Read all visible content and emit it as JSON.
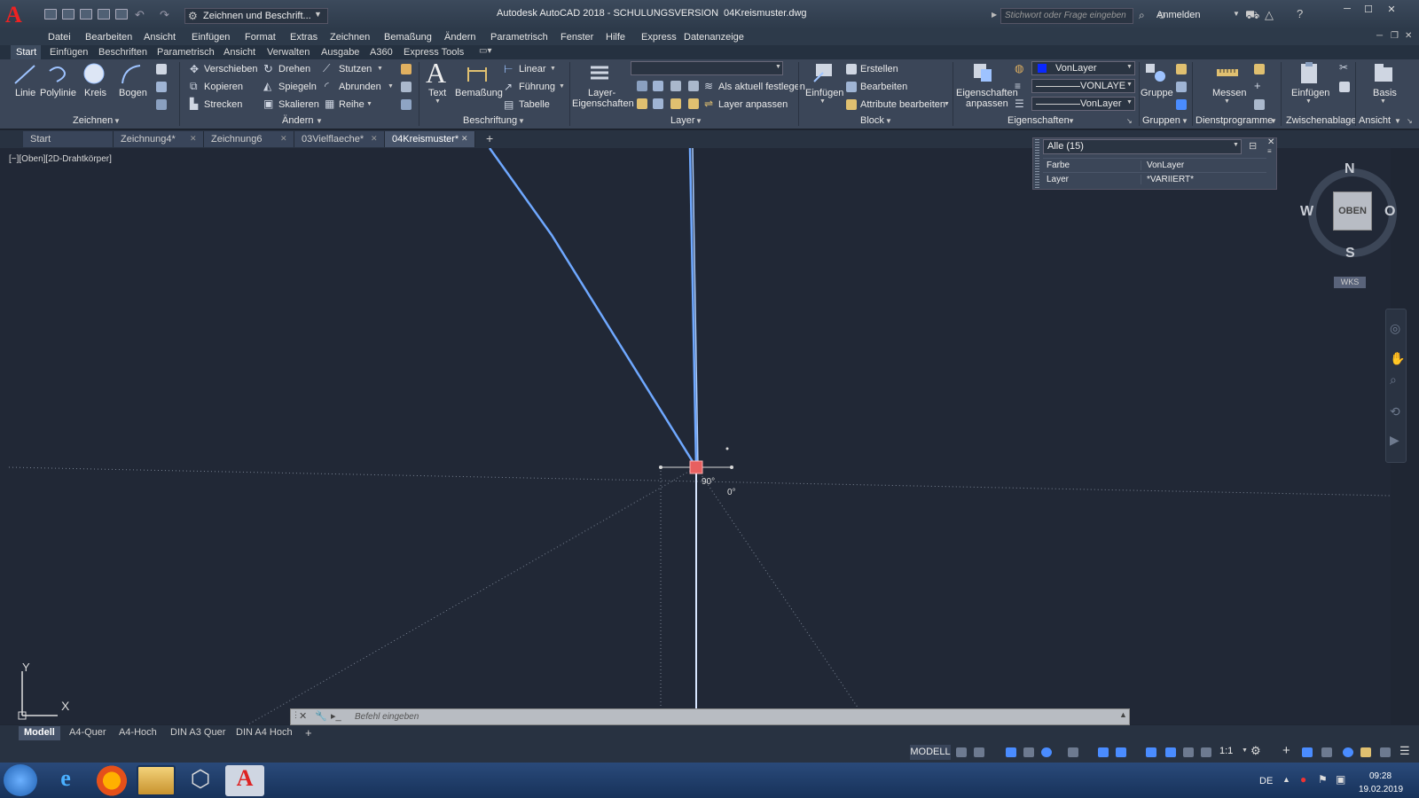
{
  "titlebar": {
    "workspace": "Zeichnen und Beschrift...",
    "app_title": "Autodesk AutoCAD 2018 - SCHULUNGSVERSION",
    "file_title": "04Kreismuster.dwg",
    "search_placeholder": "Stichwort oder Frage eingeben",
    "login": "Anmelden"
  },
  "menu": [
    "Datei",
    "Bearbeiten",
    "Ansicht",
    "Einfügen",
    "Format",
    "Extras",
    "Zeichnen",
    "Bemaßung",
    "Ändern",
    "Parametrisch",
    "Fenster",
    "Hilfe",
    "Express",
    "Datenanzeige"
  ],
  "ribbon_tabs": [
    "Start",
    "Einfügen",
    "Beschriften",
    "Parametrisch",
    "Ansicht",
    "Verwalten",
    "Ausgabe",
    "A360",
    "Express Tools"
  ],
  "ribbon": {
    "zeichnen": {
      "title": "Zeichnen",
      "linie": "Linie",
      "polylinie": "Polylinie",
      "kreis": "Kreis",
      "bogen": "Bogen"
    },
    "aendern": {
      "title": "Ändern",
      "verschieben": "Verschieben",
      "drehen": "Drehen",
      "stutzen": "Stutzen",
      "kopieren": "Kopieren",
      "spiegeln": "Spiegeln",
      "abrunden": "Abrunden",
      "strecken": "Strecken",
      "skalieren": "Skalieren",
      "reihe": "Reihe"
    },
    "beschriftung": {
      "title": "Beschriftung",
      "text": "Text",
      "bemassung": "Bemaßung",
      "linear": "Linear",
      "fuehrung": "Führung",
      "tabelle": "Tabelle"
    },
    "layer": {
      "title": "Layer",
      "eigenschaften_1": "Layer-",
      "eigenschaften_2": "Eigenschaften",
      "aktuell": "Als aktuell festlegen",
      "anpassen": "Layer anpassen"
    },
    "block": {
      "title": "Block",
      "einfuegen": "Einfügen",
      "erstellen": "Erstellen",
      "bearbeiten": "Bearbeiten",
      "attribute": "Attribute bearbeiten"
    },
    "eigenschaften": {
      "title": "Eigenschaften",
      "anpassen_1": "Eigenschaften",
      "anpassen_2": "anpassen",
      "color": "VonLayer",
      "linetype": "VONLAYE",
      "lineweight": "VonLayer"
    },
    "gruppen": {
      "title": "Gruppen",
      "gruppe": "Gruppe"
    },
    "dienst": {
      "title": "Dienstprogramme",
      "messen": "Messen"
    },
    "zwischenablage": {
      "title": "Zwischenablage",
      "einfuegen": "Einfügen"
    },
    "ansicht": {
      "title": "Ansicht",
      "basis": "Basis"
    }
  },
  "doc_tabs": [
    "Start",
    "Zeichnung4*",
    "Zeichnung6",
    "03Vielflaeche*",
    "04Kreismuster*"
  ],
  "viewport_label": "[−][Oben][2D-Drahtkörper]",
  "properties": {
    "selection": "Alle (15)",
    "rows": [
      {
        "key": "Farbe",
        "value": "VonLayer"
      },
      {
        "key": "Layer",
        "value": "*VARIIERT*"
      }
    ]
  },
  "viewcube": {
    "n": "N",
    "s": "S",
    "w": "W",
    "o": "O",
    "face": "OBEN",
    "wcs": "WKS"
  },
  "canvas": {
    "angle_label": "90°",
    "zero_label": "0°",
    "ucs_x": "X",
    "ucs_y": "Y"
  },
  "command": {
    "placeholder": "Befehl eingeben"
  },
  "layout_tabs": [
    "Modell",
    "A4-Quer",
    "A4-Hoch",
    "DIN A3 Quer",
    "DIN A4 Hoch"
  ],
  "status": {
    "model": "MODELL",
    "scale": "1:1"
  },
  "taskbar": {
    "lang": "DE",
    "time": "09:28",
    "date": "19.02.2019"
  },
  "colors": {
    "accent": "#4a8cff",
    "grip": "#e86060",
    "line": "#6fa8ff"
  }
}
